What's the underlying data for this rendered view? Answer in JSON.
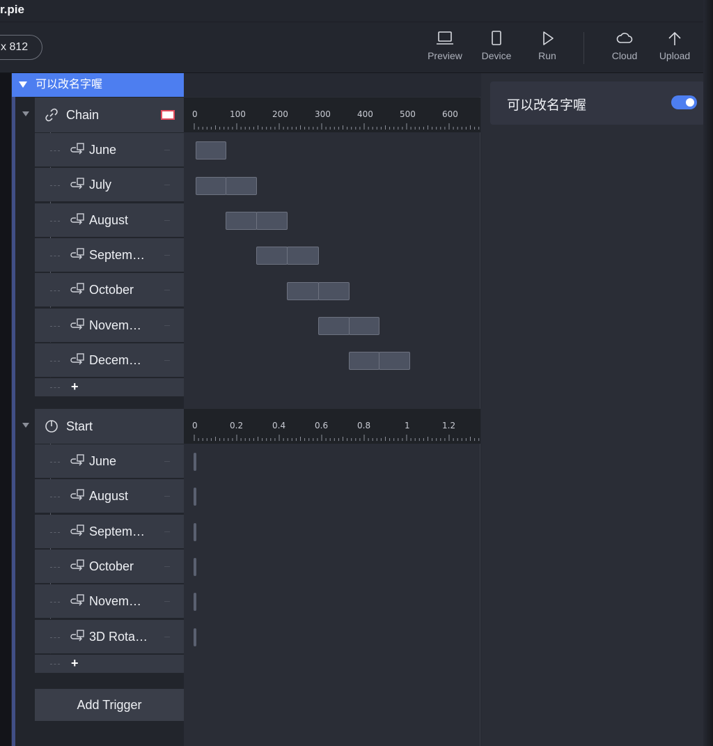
{
  "window": {
    "title": "r.pie"
  },
  "toolbar": {
    "size_label": "x 812",
    "tools": [
      {
        "label": "Preview",
        "icon": "laptop-icon"
      },
      {
        "label": "Device",
        "icon": "phone-icon"
      },
      {
        "label": "Run",
        "icon": "play-icon"
      },
      {
        "label": "Cloud",
        "icon": "cloud-icon"
      },
      {
        "label": "Upload",
        "icon": "upload-arrow-icon"
      }
    ]
  },
  "group": {
    "name": "可以改名字喔"
  },
  "sections": [
    {
      "title": "Chain",
      "icon": "link-icon",
      "chip_color": "#ffffff",
      "ruler_ticks": [
        "0",
        "100",
        "200",
        "300",
        "400",
        "500",
        "600"
      ],
      "items": [
        {
          "label": "June"
        },
        {
          "label": "July"
        },
        {
          "label": "August"
        },
        {
          "label": "Septem…"
        },
        {
          "label": "October"
        },
        {
          "label": "Novem…"
        },
        {
          "label": "Decem…"
        }
      ],
      "add_label": "+"
    },
    {
      "title": "Start",
      "icon": "power-icon",
      "ruler_ticks": [
        "0",
        "0.2",
        "0.4",
        "0.6",
        "0.8",
        "1",
        "1.2"
      ],
      "items": [
        {
          "label": "June"
        },
        {
          "label": "August"
        },
        {
          "label": "Septem…"
        },
        {
          "label": "October"
        },
        {
          "label": "Novem…"
        },
        {
          "label": "3D Rota…"
        }
      ],
      "add_label": "+"
    }
  ],
  "add_trigger_label": "Add Trigger",
  "properties": {
    "name": "可以改名字喔",
    "enabled": true
  },
  "colors": {
    "accent": "#4d7ef0",
    "panel": "#363a45",
    "background": "#262932"
  }
}
